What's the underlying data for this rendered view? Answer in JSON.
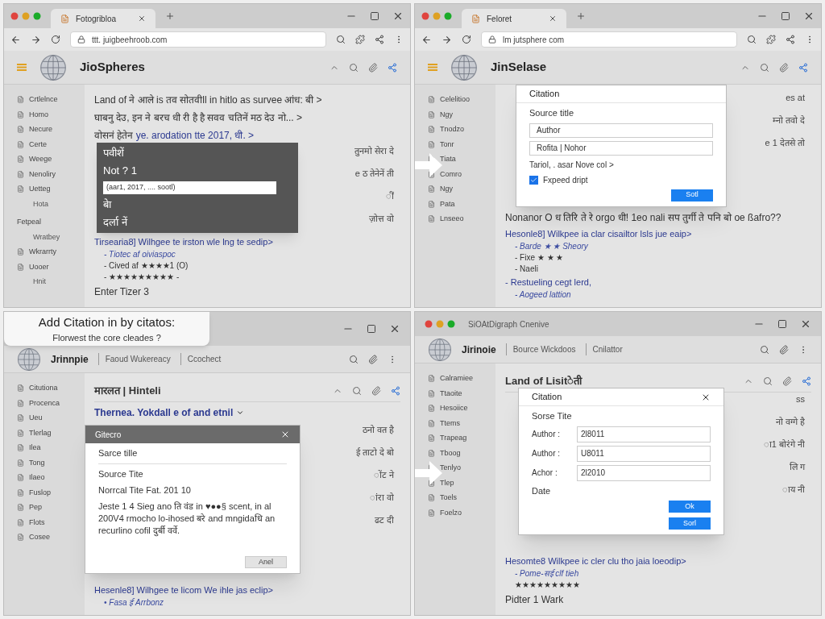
{
  "panels": [
    {
      "arrow": false,
      "chrome": {
        "kind": "tabbed",
        "tab_title": "Fotogribloa",
        "url": "ttt. juigbeehroob.com"
      },
      "header": {
        "kind": "site",
        "name": "JioSpheres"
      },
      "sidebar": [
        {
          "kind": "item",
          "label": "Crtlelnce"
        },
        {
          "kind": "item",
          "label": "Homo"
        },
        {
          "kind": "item",
          "label": "Necure"
        },
        {
          "kind": "item",
          "label": "Certe"
        },
        {
          "kind": "item",
          "label": "Weege"
        },
        {
          "kind": "item",
          "label": "Nenoliry"
        },
        {
          "kind": "item",
          "label": "Uetteg"
        },
        {
          "kind": "sub",
          "label": "Hota"
        },
        {
          "kind": "heading",
          "label": "Fetpeal"
        },
        {
          "kind": "sub",
          "label": "Wratbey"
        },
        {
          "kind": "item",
          "label": "Wkrarrty"
        },
        {
          "kind": "item",
          "label": "Uooer"
        },
        {
          "kind": "sub",
          "label": "Hnit"
        }
      ],
      "content": [
        {
          "kind": "text",
          "text": "Land of ने आले is तव सोतवी‌ll in hitlo as survee आंध: बी >"
        },
        {
          "kind": "text",
          "text": "घाबनु देउ, इन ने बरच धी री है है सवव चतिनें मठ देउ नो... >"
        },
        {
          "kind": "mixed",
          "text": "वोसनं हेतेन",
          "link": "ye. arodation tte 2017, धी. >"
        },
        {
          "kind": "fragment",
          "text": "तुनमो सेरा दे"
        },
        {
          "kind": "fragment",
          "text": "e ठ तेनेनें ती"
        },
        {
          "kind": "fragment",
          "text": "ीं"
        },
        {
          "kind": "fragment",
          "text": "ज़ोत्त वो"
        },
        {
          "kind": "link",
          "text": "Tirsearia8] Wilhgee te irston wle lng te sedip>"
        },
        {
          "kind": "bullet_link",
          "text": "- Tiotec af oiviaspoc"
        },
        {
          "kind": "bullet",
          "text": "- Cived af ★★★★1 (O)"
        },
        {
          "kind": "bullet",
          "text": "- ★★★★★★★★★ -"
        },
        {
          "kind": "text",
          "text": "Enter Tizer 3"
        }
      ],
      "overlay": {
        "kind": "menu",
        "items": [
          {
            "kind": "option",
            "text": "पवीशें"
          },
          {
            "kind": "option",
            "text": "Not ? 1"
          },
          {
            "kind": "input",
            "text": "(aar1, 2017, .... sootl)"
          },
          {
            "kind": "option",
            "text": "बेा"
          },
          {
            "kind": "option",
            "text": "दर्ला नें"
          }
        ]
      }
    },
    {
      "arrow": true,
      "chrome": {
        "kind": "tabbed",
        "tab_title": "Feloret",
        "url": "lm jutsphere com"
      },
      "header": {
        "kind": "site",
        "name": "JinSelase"
      },
      "sidebar": [
        {
          "kind": "item",
          "label": "Celelitioo"
        },
        {
          "kind": "item",
          "label": "Ngy"
        },
        {
          "kind": "item",
          "label": "Tnodzo"
        },
        {
          "kind": "item",
          "label": "Tonr"
        },
        {
          "kind": "item",
          "label": "Tiata"
        },
        {
          "kind": "item",
          "label": "Comro"
        },
        {
          "kind": "item",
          "label": "Ngy"
        },
        {
          "kind": "item",
          "label": "Pata"
        },
        {
          "kind": "item",
          "label": "Lnseeo"
        }
      ],
      "content": [
        {
          "kind": "fragment",
          "text": "es at"
        },
        {
          "kind": "fragment",
          "text": "म्नो तवो दे"
        },
        {
          "kind": "fragment",
          "text": "e 1 देतसे तो"
        },
        {
          "kind": "text",
          "text": "Nonanor O ध तिरि ते रे orgo धी! 1eo nali सप तुर्गी ते पनि बो oe ßafro??"
        },
        {
          "kind": "link",
          "text": "Hesonle8] Wilkpee ia clar cisailtor lsls jue eaip>"
        },
        {
          "kind": "bullet_link",
          "text": "- Barde ★ ★ Sheory"
        },
        {
          "kind": "bullet",
          "text": "- Fixe ★ ★ ★"
        },
        {
          "kind": "bullet",
          "text": "- Naeli"
        },
        {
          "kind": "link",
          "text": "- Restueling cegt lerd,"
        },
        {
          "kind": "bullet_link",
          "text": "- Aogeed lattion"
        }
      ],
      "overlay": {
        "kind": "dialog",
        "title": "Citation",
        "close": false,
        "fields": [
          {
            "kind": "heading",
            "text": "Source title"
          },
          {
            "kind": "input",
            "text": "Author"
          },
          {
            "kind": "input",
            "text": "Rofita | Nohor"
          },
          {
            "kind": "link",
            "text": "Tariol, . asar Nove col >"
          },
          {
            "kind": "checkbox",
            "text": "Fxpeed dript",
            "checked": true
          }
        ],
        "buttons": [
          {
            "kind": "primary",
            "label": "Sotl"
          }
        ]
      }
    },
    {
      "arrow": false,
      "callout": {
        "title": "Add Citation in by citatos:",
        "subtitle": "Florwest the core cleades ?"
      },
      "chrome": {
        "kind": "bare"
      },
      "header": {
        "kind": "breadcrumb",
        "name": "Jrinnpie",
        "segments": [
          "Faoud Wukereacy",
          "Ccochect"
        ]
      },
      "sidebar": [
        {
          "kind": "item",
          "label": "Citutiona"
        },
        {
          "kind": "item",
          "label": "Procenca"
        },
        {
          "kind": "item",
          "label": "Ueu"
        },
        {
          "kind": "item",
          "label": "Tlerlag"
        },
        {
          "kind": "item",
          "label": "Ilea"
        },
        {
          "kind": "item",
          "label": "Tong"
        },
        {
          "kind": "item",
          "label": "Ilaeo"
        },
        {
          "kind": "item",
          "label": "Fuslop"
        },
        {
          "kind": "item",
          "label": "Pep"
        },
        {
          "kind": "item",
          "label": "Flots"
        },
        {
          "kind": "item",
          "label": "Cosee"
        }
      ],
      "content": [
        {
          "kind": "heading",
          "text": "मारलत | Hinteli"
        },
        {
          "kind": "heading_dropdown",
          "text": "Thernea. Yokdall e of and etnil"
        },
        {
          "kind": "fragment",
          "text": "ठनो वत है"
        },
        {
          "kind": "fragment",
          "text": "ई ताटो दे बो"
        },
        {
          "kind": "fragment",
          "text": "ोंट ने"
        },
        {
          "kind": "fragment",
          "text": "ांरा वो"
        },
        {
          "kind": "fragment",
          "text": "ढट दी"
        },
        {
          "kind": "link",
          "text": "Hesenle8] Wilhgee te licom We ihle jas eclip>"
        },
        {
          "kind": "bullet_link",
          "text": "• Fasa ई Arrbonz"
        }
      ],
      "overlay": {
        "kind": "window_dialog",
        "title": "Gitecro",
        "close": true,
        "fields": [
          {
            "kind": "section",
            "text": "Sarce tille"
          },
          {
            "kind": "heading",
            "text": "Source Tite"
          },
          {
            "kind": "heading",
            "text": "Norrcal Tite Fat. 201 10"
          },
          {
            "kind": "paragraph",
            "text": "Jeste 1 4 Sieg ano ति वंड in ♥●●§ scent, in al 200V4 rmocho lo-ihosed बरे and mngidaधि an recurlino cofil दुर्बी वर्वे."
          }
        ],
        "buttons": [
          {
            "kind": "secondary",
            "label": "Anel"
          }
        ]
      }
    },
    {
      "arrow": true,
      "chrome": {
        "kind": "titled",
        "title": "SiOAtDigraph Cnenive"
      },
      "header": {
        "kind": "breadcrumb",
        "name": "Jirinoie",
        "segments": [
          "Bource Wickdoos",
          "Cnilattor"
        ]
      },
      "sidebar": [
        {
          "kind": "item",
          "label": "Calramiee"
        },
        {
          "kind": "item",
          "label": "Ttaoite"
        },
        {
          "kind": "item",
          "label": "Hesoiice"
        },
        {
          "kind": "item",
          "label": "Ttems"
        },
        {
          "kind": "item",
          "label": "Trapeag"
        },
        {
          "kind": "item",
          "label": "Tboog"
        },
        {
          "kind": "item",
          "label": "Tenlyo"
        },
        {
          "kind": "item",
          "label": "Tlep"
        },
        {
          "kind": "item",
          "label": "Toels"
        },
        {
          "kind": "item",
          "label": "Foelzo"
        }
      ],
      "content": [
        {
          "kind": "heading",
          "text": "Land of Lisitेती"
        },
        {
          "kind": "fragment",
          "text": "ss"
        },
        {
          "kind": "fragment",
          "text": "नो वग्गे है"
        },
        {
          "kind": "fragment",
          "text": "ा1 बोरंगे नी"
        },
        {
          "kind": "fragment",
          "text": "लि ग"
        },
        {
          "kind": "fragment",
          "text": "ाय नी"
        },
        {
          "kind": "link",
          "text": "Hesomte8 Wilkpee ic cler clu tho jaia loeodip>"
        },
        {
          "kind": "bullet_link",
          "text": "- Pome-सई clf tieh"
        },
        {
          "kind": "bullet",
          "text": "★★★★★★★★★"
        },
        {
          "kind": "text",
          "text": "Pidter 1 Wark"
        }
      ],
      "overlay": {
        "kind": "form_dialog",
        "title": "Citation",
        "close": true,
        "fields": [
          {
            "kind": "heading",
            "text": "Sorse Tite"
          },
          {
            "kind": "labeled_input",
            "label": "Author :",
            "text": "2l8011"
          },
          {
            "kind": "labeled_input",
            "label": "Author :",
            "text": "U8011"
          },
          {
            "kind": "labeled_input",
            "label": "Achor :",
            "text": "2l2010"
          },
          {
            "kind": "heading",
            "text": "Date"
          }
        ],
        "buttons": [
          {
            "kind": "primary",
            "label": "Ok"
          },
          {
            "kind": "primary",
            "label": "Sorl"
          }
        ]
      }
    }
  ]
}
